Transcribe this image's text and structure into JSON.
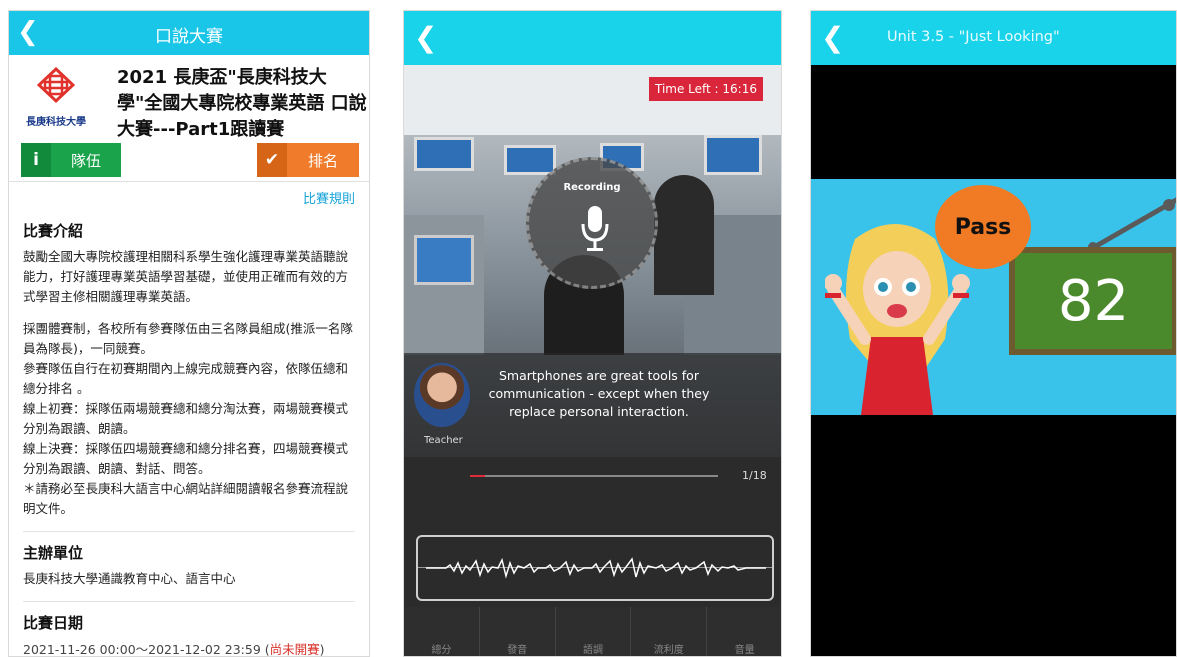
{
  "panel1": {
    "header_title": "口說大賽",
    "back_icon": "chevron-left-icon",
    "logo_text": "長庚科技大學",
    "competition_title": "2021 長庚盃\"長庚科技大學\"全國大專院校專業英語 口說大賽---Part1跟讀賽",
    "team_button": "隊伍",
    "rank_button": "排名",
    "rules_link": "比賽規則",
    "intro_heading": "比賽介紹",
    "intro_para1": "鼓勵全國大專院校護理相關科系學生強化護理專業英語聽說能力，打好護理專業英語學習基礎，並使用正確而有效的方式學習主修相關護理專業英語。",
    "intro_para2": "採團體賽制，各校所有參賽隊伍由三名隊員組成(推派一名隊員為隊長)，一同競賽。",
    "intro_para3": "參賽隊伍自行在初賽期間內上線完成競賽內容，依隊伍總和總分排名 。",
    "intro_para4": "線上初賽：採隊伍兩場競賽總和總分淘汰賽，兩場競賽模式分別為跟讀、朗讀。",
    "intro_para5": "線上決賽：採隊伍四場競賽總和總分排名賽，四場競賽模式分別為跟讀、朗讀、對話、問答。",
    "intro_para6": "＊請務必至長庚科大語言中心網站詳細閱讀報名參賽流程說明文件。",
    "organizer_heading": "主辦單位",
    "organizer_text": "長庚科技大學通識教育中心、語言中心",
    "date_heading": "比賽日期",
    "date_text": "2021-11-26 00:00〜2021-12-02 23:59 (",
    "date_status": "尚未開賽",
    "date_close": ")"
  },
  "panel2": {
    "back_icon": "chevron-left-icon",
    "time_left": "Time Left : 16:16",
    "recording_label": "Recording",
    "sentence": "Smartphones are great tools for communication - except when they replace personal interaction.",
    "teacher_label": "Teacher",
    "page_count": "1/18",
    "progress": 0.06,
    "score_tabs": [
      "總分",
      "發音",
      "語調",
      "流利度",
      "音量"
    ]
  },
  "panel3": {
    "back_icon": "chevron-left-icon",
    "header_title": "Unit 3.5 - \"Just Looking\"",
    "pass_text": "Pass",
    "score": "82"
  },
  "colors": {
    "header_cyan": "#19c6e8",
    "team_green": "#1aa34a",
    "rank_orange": "#f07b2a",
    "status_red": "#d9322b",
    "timer_red": "#d9263a"
  }
}
